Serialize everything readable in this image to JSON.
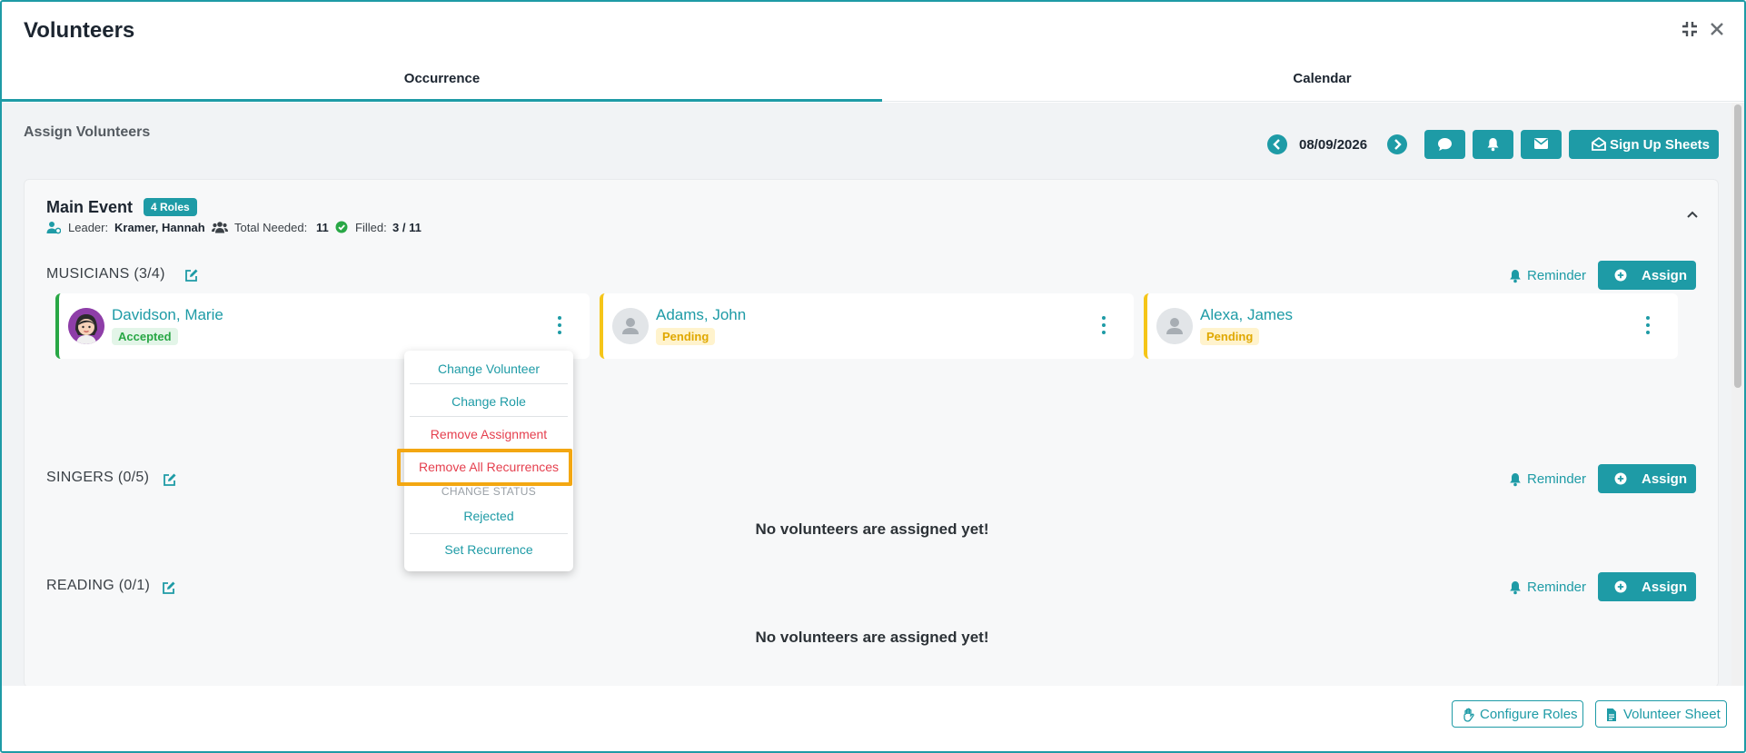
{
  "window": {
    "title": "Volunteers",
    "compress_icon": "compress-icon",
    "close_icon": "close-icon"
  },
  "tabs": [
    {
      "label": "Occurrence",
      "active": true
    },
    {
      "label": "Calendar",
      "active": false
    }
  ],
  "toolbar": {
    "section_title": "Assign Volunteers",
    "date": "08/09/2026",
    "sign_up_label": "Sign Up Sheets",
    "icons": [
      "chevron-left-icon",
      "chevron-right-icon",
      "comment-icon",
      "bell-icon",
      "envelope-icon",
      "envelope-open-icon"
    ]
  },
  "event": {
    "title": "Main Event",
    "roles_badge": "4 Roles",
    "leader_label": "Leader:",
    "leader_name": "Kramer, Hannah",
    "total_label": "Total Needed:",
    "total_value": "11",
    "filled_label": "Filled:",
    "filled_value": "3 / 11"
  },
  "roles": [
    {
      "title": "MUSICIANS (3/4)",
      "reminder_label": "Reminder",
      "assign_label": "Assign",
      "volunteers": [
        {
          "name": "Davidson, Marie",
          "status": "Accepted"
        },
        {
          "name": "Adams, John",
          "status": "Pending"
        },
        {
          "name": "Alexa, James",
          "status": "Pending"
        }
      ]
    },
    {
      "title": "SINGERS (0/5)",
      "reminder_label": "Reminder",
      "assign_label": "Assign",
      "empty_message": "No volunteers are assigned yet!"
    },
    {
      "title": "READING (0/1)",
      "reminder_label": "Reminder",
      "assign_label": "Assign",
      "empty_message": "No volunteers are assigned yet!"
    }
  ],
  "menu": {
    "change_volunteer": "Change Volunteer",
    "change_role": "Change Role",
    "remove_assignment": "Remove Assignment",
    "remove_all_recurrences": "Remove All Recurrences",
    "change_status_header": "CHANGE STATUS",
    "rejected": "Rejected",
    "set_recurrence": "Set Recurrence"
  },
  "footer": {
    "configure_roles": "Configure Roles",
    "volunteer_sheet": "Volunteer Sheet"
  },
  "colors": {
    "accent": "#1e9ba6",
    "accepted": "#28a745",
    "pending": "#f5c518",
    "danger": "#e53f4e",
    "highlight": "#f3a712"
  }
}
